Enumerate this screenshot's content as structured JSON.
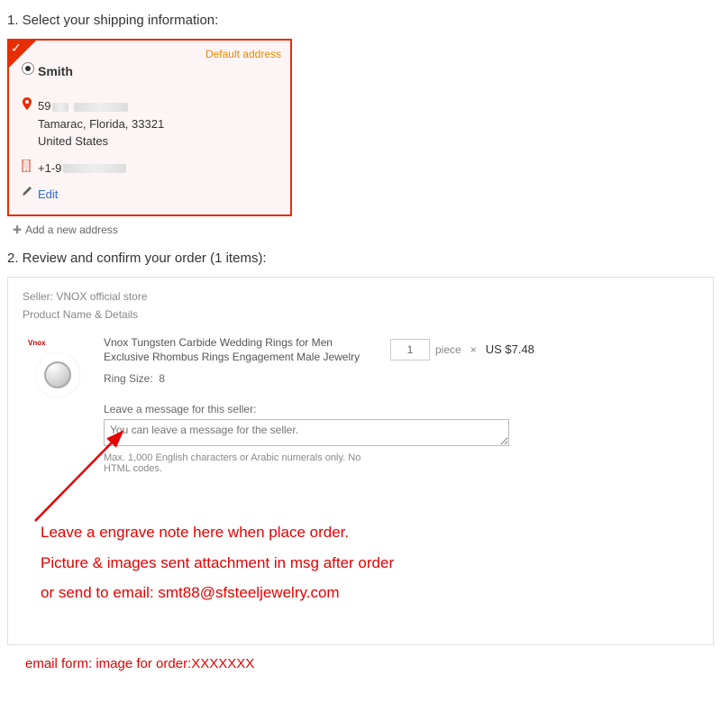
{
  "step1": {
    "title": "1. Select your shipping information:"
  },
  "address": {
    "default_label": "Default address",
    "name": "Smith",
    "line1_prefix": "59",
    "city_state_zip": "Tamarac, Florida, 33321",
    "country": "United States",
    "phone_prefix": "+1-9",
    "edit": "Edit"
  },
  "add_address": "Add a new address",
  "step2": {
    "title": "2. Review and confirm your order (1 items):"
  },
  "order": {
    "seller_label": "Seller:",
    "seller_name": "VNOX official store",
    "header": "Product Name & Details",
    "product_title": "Vnox Tungsten Carbide Wedding Rings for Men Exclusive Rhombus Rings Engagement Male Jewelry",
    "variant_label": "Ring Size:",
    "variant_value": "8",
    "msg_label": "Leave a message for this seller:",
    "msg_placeholder": "You can leave a message for the seller.",
    "msg_hint": "Max. 1,000 English characters or Arabic numerals only. No HTML codes.",
    "qty": "1",
    "unit": "piece",
    "times": "×",
    "price": "US $7.48",
    "thumb_brand": "Vnox"
  },
  "annotation": {
    "line1": "Leave a engrave note here when place order.",
    "line2": "Picture & images sent attachment in msg after order",
    "line3": "or send to email: smt88@sfsteeljewelry.com",
    "line4": "email form: image for order:XXXXXXX"
  }
}
